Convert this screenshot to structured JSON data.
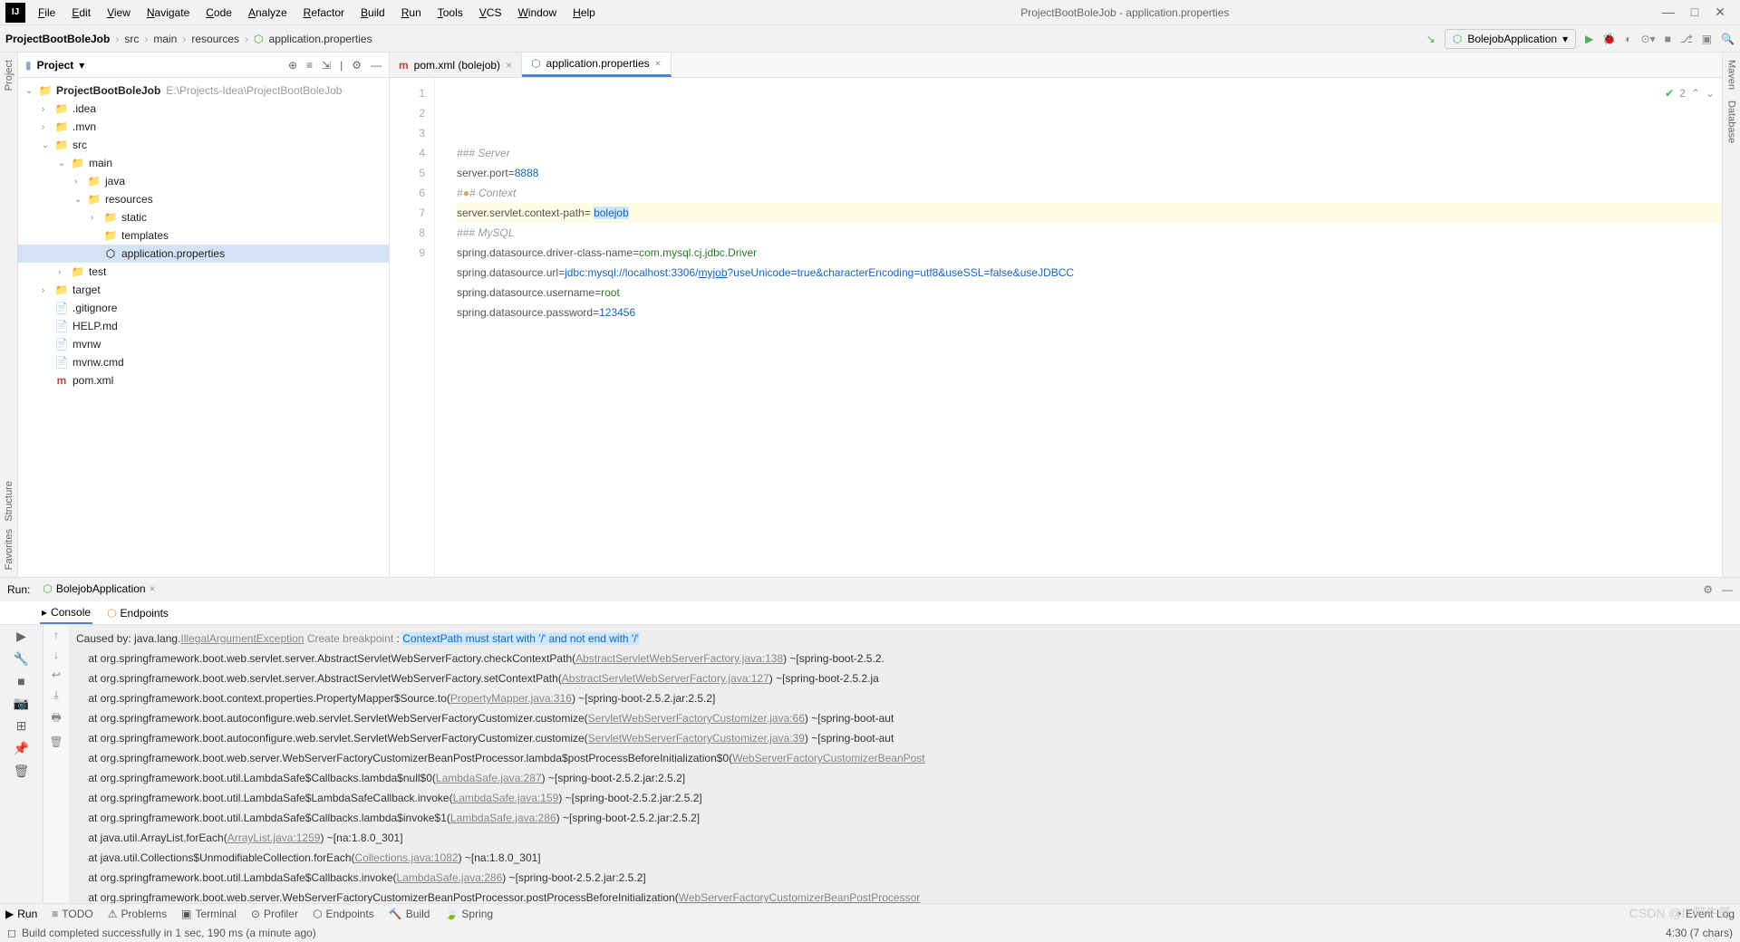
{
  "window": {
    "title": "ProjectBootBoleJob - application.properties",
    "minimize": "—",
    "maximize": "□",
    "close": "✕"
  },
  "menu": [
    "File",
    "Edit",
    "View",
    "Navigate",
    "Code",
    "Analyze",
    "Refactor",
    "Build",
    "Run",
    "Tools",
    "VCS",
    "Window",
    "Help"
  ],
  "breadcrumb": {
    "project": "ProjectBootBoleJob",
    "parts": [
      "src",
      "main",
      "resources",
      "application.properties"
    ]
  },
  "runConfig": {
    "name": "BolejobApplication"
  },
  "projectPanel": {
    "title": "Project",
    "root": {
      "name": "ProjectBootBoleJob",
      "hint": "E:\\Projects-Idea\\ProjectBootBoleJob"
    },
    "tree": [
      {
        "depth": 1,
        "arrow": "›",
        "icon": "folder",
        "label": ".idea"
      },
      {
        "depth": 1,
        "arrow": "›",
        "icon": "folder",
        "label": ".mvn"
      },
      {
        "depth": 1,
        "arrow": "⌄",
        "icon": "folder",
        "label": "src"
      },
      {
        "depth": 2,
        "arrow": "⌄",
        "icon": "folder",
        "label": "main"
      },
      {
        "depth": 3,
        "arrow": "›",
        "icon": "folder",
        "label": "java"
      },
      {
        "depth": 3,
        "arrow": "⌄",
        "icon": "folder",
        "label": "resources"
      },
      {
        "depth": 4,
        "arrow": "›",
        "icon": "folder",
        "label": "static"
      },
      {
        "depth": 4,
        "arrow": "",
        "icon": "folder",
        "label": "templates"
      },
      {
        "depth": 4,
        "arrow": "",
        "icon": "props",
        "label": "application.properties",
        "selected": true
      },
      {
        "depth": 2,
        "arrow": "›",
        "icon": "folder",
        "label": "test"
      },
      {
        "depth": 1,
        "arrow": "›",
        "icon": "folder-orange",
        "label": "target"
      },
      {
        "depth": 1,
        "arrow": "",
        "icon": "file",
        "label": ".gitignore"
      },
      {
        "depth": 1,
        "arrow": "",
        "icon": "file",
        "label": "HELP.md"
      },
      {
        "depth": 1,
        "arrow": "",
        "icon": "file",
        "label": "mvnw"
      },
      {
        "depth": 1,
        "arrow": "",
        "icon": "file",
        "label": "mvnw.cmd"
      },
      {
        "depth": 1,
        "arrow": "",
        "icon": "maven",
        "label": "pom.xml"
      }
    ]
  },
  "editorTabs": [
    {
      "icon": "maven",
      "label": "pom.xml (bolejob)",
      "active": false
    },
    {
      "icon": "props",
      "label": "application.properties",
      "active": true
    }
  ],
  "code": {
    "lines": [
      {
        "n": 1,
        "html": "<span class='comment'>### Server</span>"
      },
      {
        "n": 2,
        "html": "<span class='key'>server.port</span><span class='eq'>=</span><span class='num'>8888</span>"
      },
      {
        "n": 3,
        "html": "<span class='comment'>#<span style='color:#d4a65a;'>●</span># Context</span>"
      },
      {
        "n": 4,
        "html": "<span class='key'>server.servlet.context-path</span><span class='eq'>= </span><span class='hl'>bolejob</span>",
        "bg": true
      },
      {
        "n": 5,
        "html": "<span class='comment'>### MySQL</span>"
      },
      {
        "n": 6,
        "html": "<span class='key'>spring.datasource.driver-class-name</span><span class='eq'>=</span><span class='val'>com.mysql.cj.jdbc.Driver</span>"
      },
      {
        "n": 7,
        "html": "<span class='key'>spring.datasource.url</span><span class='eq'>=</span><span class='url'>jdbc:mysql://localhost:3306/</span><span class='urllink'>myjob</span><span class='url'>?useUnicode=true&characterEncoding=utf8&useSSL=false&useJDBCC</span>"
      },
      {
        "n": 8,
        "html": "<span class='key'>spring.datasource.username</span><span class='eq'>=</span><span class='val'>root</span>"
      },
      {
        "n": 9,
        "html": "<span class='key'>spring.datasource.password</span><span class='eq'>=</span><span class='num'>123456</span>"
      }
    ],
    "inspection": "2"
  },
  "run": {
    "title": "Run:",
    "app": "BolejobApplication",
    "subtabs": [
      "Console",
      "Endpoints"
    ],
    "console": [
      "Caused by: java.lang.<span class='link'>IllegalArgumentException</span> <span class='bp'>Create breakpoint</span> : <span class='hl-err'>ContextPath must start with '/' and not end with '/'</span>",
      "    at org.springframework.boot.web.servlet.server.AbstractServletWebServerFactory.checkContextPath(<span class='link'>AbstractServletWebServerFactory.java:138</span>) ~[spring-boot-2.5.2.",
      "    at org.springframework.boot.web.servlet.server.AbstractServletWebServerFactory.setContextPath(<span class='link'>AbstractServletWebServerFactory.java:127</span>) ~[spring-boot-2.5.2.ja",
      "    at org.springframework.boot.context.properties.PropertyMapper$Source.to(<span class='link'>PropertyMapper.java:316</span>) ~[spring-boot-2.5.2.jar:2.5.2]",
      "    at org.springframework.boot.autoconfigure.web.servlet.ServletWebServerFactoryCustomizer.customize(<span class='link'>ServletWebServerFactoryCustomizer.java:66</span>) ~[spring-boot-aut",
      "    at org.springframework.boot.autoconfigure.web.servlet.ServletWebServerFactoryCustomizer.customize(<span class='link'>ServletWebServerFactoryCustomizer.java:39</span>) ~[spring-boot-aut",
      "    at org.springframework.boot.web.server.WebServerFactoryCustomizerBeanPostProcessor.lambda$postProcessBeforeInitialization$0(<span class='link'>WebServerFactoryCustomizerBeanPost</span>",
      "    at org.springframework.boot.util.LambdaSafe$Callbacks.lambda$null$0(<span class='link'>LambdaSafe.java:287</span>) ~[spring-boot-2.5.2.jar:2.5.2]",
      "    at org.springframework.boot.util.LambdaSafe$LambdaSafeCallback.invoke(<span class='link'>LambdaSafe.java:159</span>) ~[spring-boot-2.5.2.jar:2.5.2]",
      "    at org.springframework.boot.util.LambdaSafe$Callbacks.lambda$invoke$1(<span class='link'>LambdaSafe.java:286</span>) ~[spring-boot-2.5.2.jar:2.5.2]",
      "    at java.util.ArrayList.forEach(<span class='link'>ArrayList.java:1259</span>) ~[na:1.8.0_301]",
      "    at java.util.Collections$UnmodifiableCollection.forEach(<span class='link'>Collections.java:1082</span>) ~[na:1.8.0_301]",
      "    at org.springframework.boot.util.LambdaSafe$Callbacks.invoke(<span class='link'>LambdaSafe.java:286</span>) ~[spring-boot-2.5.2.jar:2.5.2]",
      "    at org.springframework.boot.web.server.WebServerFactoryCustomizerBeanPostProcessor.postProcessBeforeInitialization(<span class='link'>WebServerFactoryCustomizerBeanPostProcessor</span>"
    ]
  },
  "bottomTabs": [
    "Run",
    "TODO",
    "Problems",
    "Terminal",
    "Profiler",
    "Endpoints",
    "Build",
    "Spring"
  ],
  "eventLog": "Event Log",
  "status": {
    "left": "Build completed successfully in 1 sec, 190 ms (a minute ago)",
    "caret": "4:30 (7 chars)"
  },
  "watermark": "CSDN @IT阿牛哥",
  "rightGutter": [
    "Maven",
    "Database"
  ],
  "leftGutter": [
    "Project"
  ],
  "leftGutter2": [
    "Structure"
  ],
  "leftGutter3": [
    "Favorites"
  ]
}
